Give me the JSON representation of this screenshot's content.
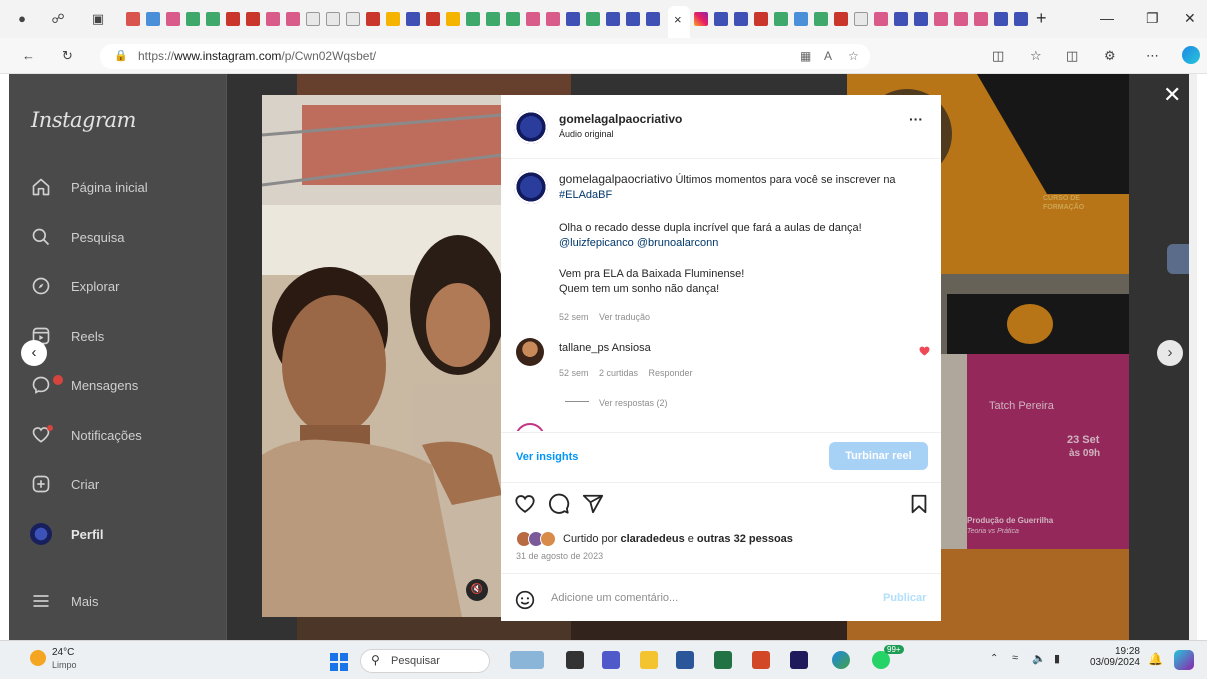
{
  "browser": {
    "url_prefix": "https://",
    "url_host": "www.instagram.com",
    "url_path": "/p/Cwn02Wqsbet/",
    "new_tab": "+",
    "tab_close": "×"
  },
  "sidebar": {
    "logo": "Instagram",
    "items": [
      {
        "label": "Página inicial",
        "icon": "home-icon"
      },
      {
        "label": "Pesquisa",
        "icon": "search-icon"
      },
      {
        "label": "Explorar",
        "icon": "compass-icon"
      },
      {
        "label": "Reels",
        "icon": "reels-icon"
      },
      {
        "label": "Mensagens",
        "icon": "messenger-icon"
      },
      {
        "label": "Notificações",
        "icon": "heart-icon"
      },
      {
        "label": "Criar",
        "icon": "plus-square-icon"
      },
      {
        "label": "Perfil",
        "icon": "profile-avatar-icon"
      },
      {
        "label": "Mais",
        "icon": "menu-icon"
      }
    ]
  },
  "grid": {
    "tile_texts": [
      "Tatch Pereira",
      "23 Set",
      "às 09h",
      "Produção de Guerrilha",
      "Teoria vs Prática",
      "CURSO DE FORMAÇÃO"
    ]
  },
  "post": {
    "username": "gomelagalpaocriativo",
    "audio": "Áudio original",
    "more": "···",
    "caption_user": "gomelagalpaocriativo",
    "caption_line1": " Últimos momentos para você se inscrever na ",
    "hashtag": "#ELAdaBF",
    "caption_line2": "Olha o recado desse dupla incrível que fará a aulas de dança!",
    "mention1": "@luizfepicanco",
    "mention2": "@brunoalarconn",
    "caption_line3": "Vem pra ELA da Baixada Fluminense!",
    "caption_line4": "Quem tem um sonho não dança!",
    "caption_age": "52 sem",
    "translate": "Ver tradução",
    "comment_user": "tallane_ps",
    "comment_text": " Ansiosa",
    "comment_age": "52 sem",
    "comment_likes": "2 curtidas",
    "reply": "Responder",
    "view_replies": "Ver respostas (2)",
    "insights": "Ver insights",
    "boost": "Turbinar reel",
    "liked_by_prefix": "Curtido por ",
    "liked_by_user": "claradedeus",
    "liked_by_suffix": " e ",
    "liked_by_others": "outras 32 pessoas",
    "date": "31 de agosto de 2023",
    "comment_placeholder": "Adicione um comentário...",
    "publish": "Publicar"
  },
  "taskbar": {
    "temp": "24°C",
    "weather": "Limpo",
    "search": "Pesquisar",
    "time": "19:28",
    "date": "03/09/2024",
    "badge": "99+"
  }
}
